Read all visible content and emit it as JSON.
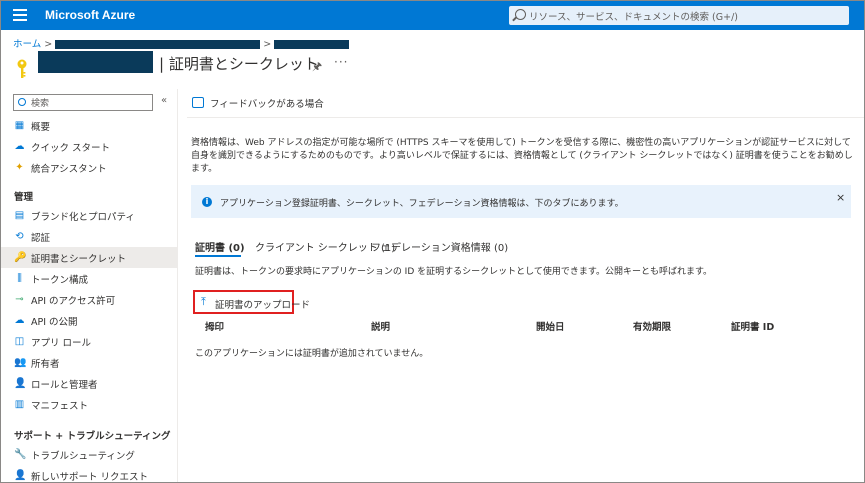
{
  "topbar": {
    "brand": "Microsoft Azure",
    "search_placeholder": "リソース、サービス、ドキュメントの検索 (G+/)"
  },
  "breadcrumb": {
    "home": "ホーム"
  },
  "title": "| 証明書とシークレット",
  "sidebar": {
    "search_placeholder": "検索",
    "items_top": [
      {
        "label": "概要",
        "icon": "overview-icon"
      },
      {
        "label": "クイック スタート",
        "icon": "quickstart-icon"
      },
      {
        "label": "統合アシスタント",
        "icon": "integration-assistant-icon"
      }
    ],
    "section_manage": "管理",
    "items_manage": [
      {
        "label": "ブランド化とプロパティ",
        "icon": "branding-icon"
      },
      {
        "label": "認証",
        "icon": "authentication-icon"
      },
      {
        "label": "証明書とシークレット",
        "icon": "key-icon"
      },
      {
        "label": "トークン構成",
        "icon": "token-icon"
      },
      {
        "label": "API のアクセス許可",
        "icon": "api-permissions-icon"
      },
      {
        "label": "API の公開",
        "icon": "expose-api-icon"
      },
      {
        "label": "アプリ ロール",
        "icon": "app-roles-icon"
      },
      {
        "label": "所有者",
        "icon": "owners-icon"
      },
      {
        "label": "ロールと管理者",
        "icon": "roles-admins-icon"
      },
      {
        "label": "マニフェスト",
        "icon": "manifest-icon"
      }
    ],
    "section_support": "サポート + トラブルシューティング",
    "items_support": [
      {
        "label": "トラブルシューティング",
        "icon": "troubleshoot-icon"
      },
      {
        "label": "新しいサポート リクエスト",
        "icon": "support-request-icon"
      }
    ]
  },
  "main": {
    "feedback": "フィードバックがある場合",
    "description": "資格情報は、Web アドレスの指定が可能な場所で (HTTPS スキーマを使用して) トークンを受信する際に、機密性の高いアプリケーションが認証サービスに対して自身を識別できるようにするためのものです。より高いレベルで保証するには、資格情報として (クライアント シークレットではなく) 証明書を使うことをお勧めします。",
    "info": "アプリケーション登録証明書、シークレット、フェデレーション資格情報は、下のタブにあります。",
    "tabs": [
      "証明書 (0)",
      "クライアント シークレット (1)",
      "フェデレーション資格情報 (0)"
    ],
    "tab_description": "証明書は、トークンの要求時にアプリケーションの ID を証明するシークレットとして使用できます。公開キーとも呼ばれます。",
    "upload_label": "証明書のアップロード",
    "table_headers": [
      "拇印",
      "説明",
      "開始日",
      "有効期限",
      "証明書 ID"
    ],
    "empty_message": "このアプリケーションには証明書が追加されていません。"
  }
}
